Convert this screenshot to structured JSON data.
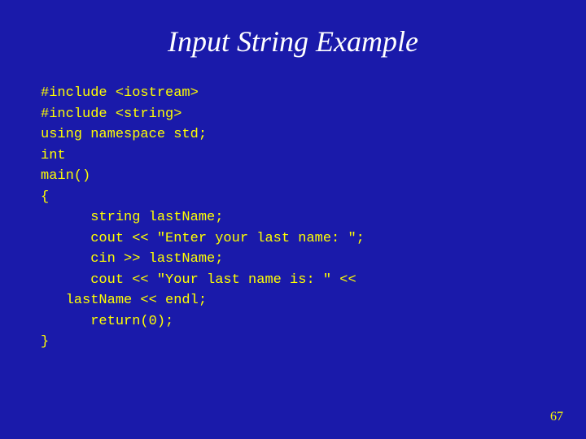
{
  "slide": {
    "title": "Input String Example",
    "slide_number": "67",
    "code_lines": [
      "#include <iostream>",
      "#include <string>",
      "using namespace std;",
      "int",
      "main()",
      "{",
      "     string lastName;",
      "     cout << \"Enter your last name: \";",
      "     cin >> lastName;",
      "     cout << \"Your last name is: \" <<",
      "  lastName << endl;",
      "   return(0);",
      "}"
    ]
  }
}
